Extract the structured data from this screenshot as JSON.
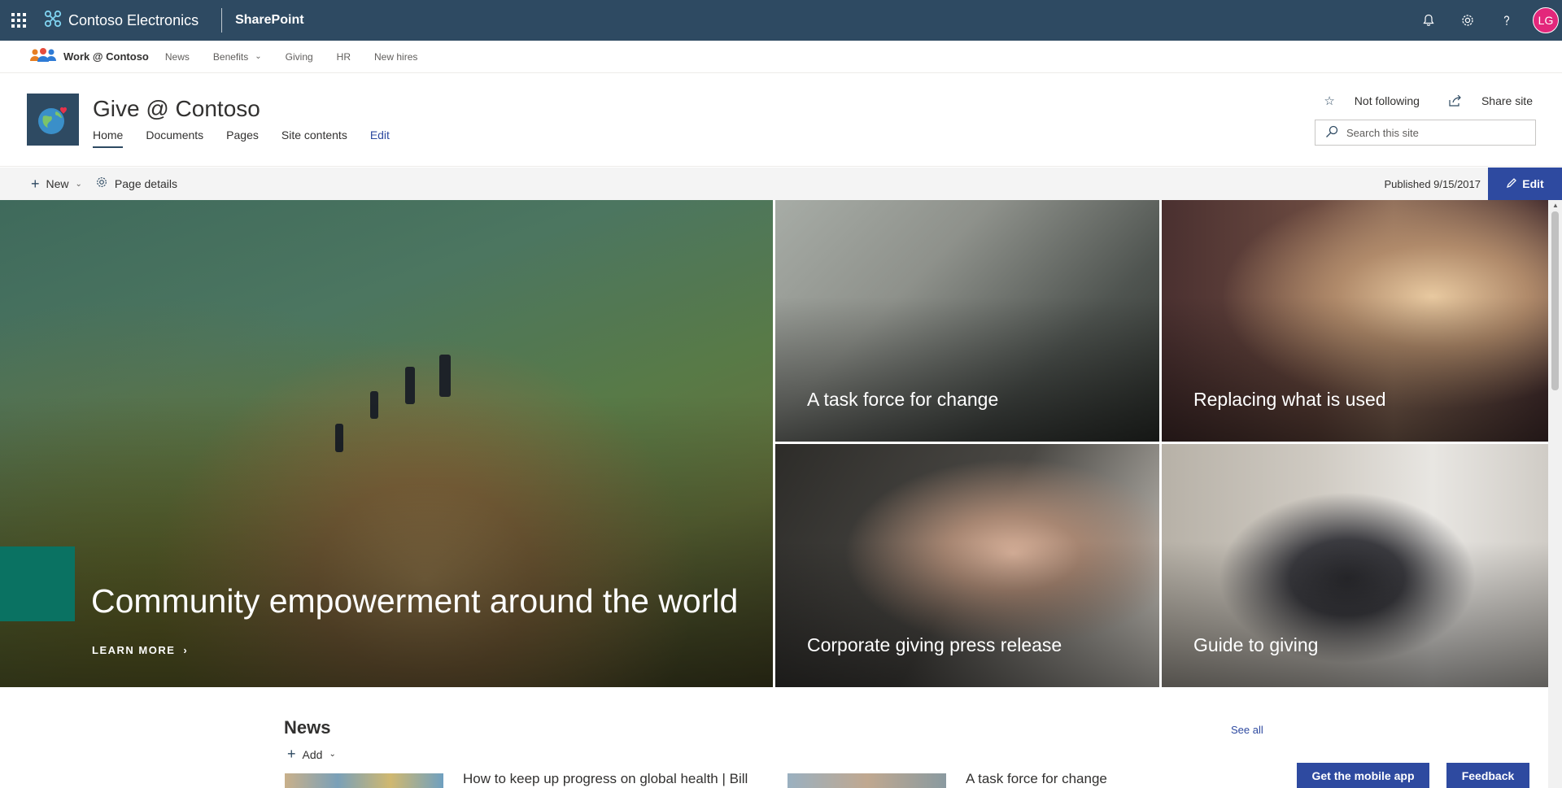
{
  "suite": {
    "brand": "Contoso Electronics",
    "app": "SharePoint",
    "avatar_initials": "LG",
    "icons": [
      "waffle-icon",
      "bell-icon",
      "gear-icon",
      "help-icon"
    ]
  },
  "hub": {
    "title": "Work @ Contoso",
    "links": [
      "News",
      "Benefits",
      "Giving",
      "HR",
      "New hires"
    ]
  },
  "site": {
    "title": "Give @ Contoso",
    "nav": [
      "Home",
      "Documents",
      "Pages",
      "Site contents",
      "Edit"
    ],
    "follow_label": "Not following",
    "share_label": "Share site",
    "search_placeholder": "Search this site"
  },
  "command_bar": {
    "new_label": "New",
    "page_details_label": "Page details",
    "published": "Published 9/15/2017",
    "edit_label": "Edit"
  },
  "hero": {
    "main_title": "Community empowerment around the world",
    "learn_more": "LEARN MORE",
    "tiles": [
      "A task force for change",
      "Replacing what is used",
      "Corporate giving press release",
      "Guide to giving"
    ]
  },
  "news": {
    "title": "News",
    "see_all": "See all",
    "add_label": "Add",
    "headlines": [
      "How to keep up progress on global health | Bill",
      "A task force for change"
    ]
  },
  "footer_buttons": {
    "mobile": "Get the mobile app",
    "feedback": "Feedback"
  },
  "colors": {
    "suite_bar": "#2e4a62",
    "accent": "#2e4aa0",
    "teal": "#0a7262",
    "avatar": "#e3277b"
  }
}
